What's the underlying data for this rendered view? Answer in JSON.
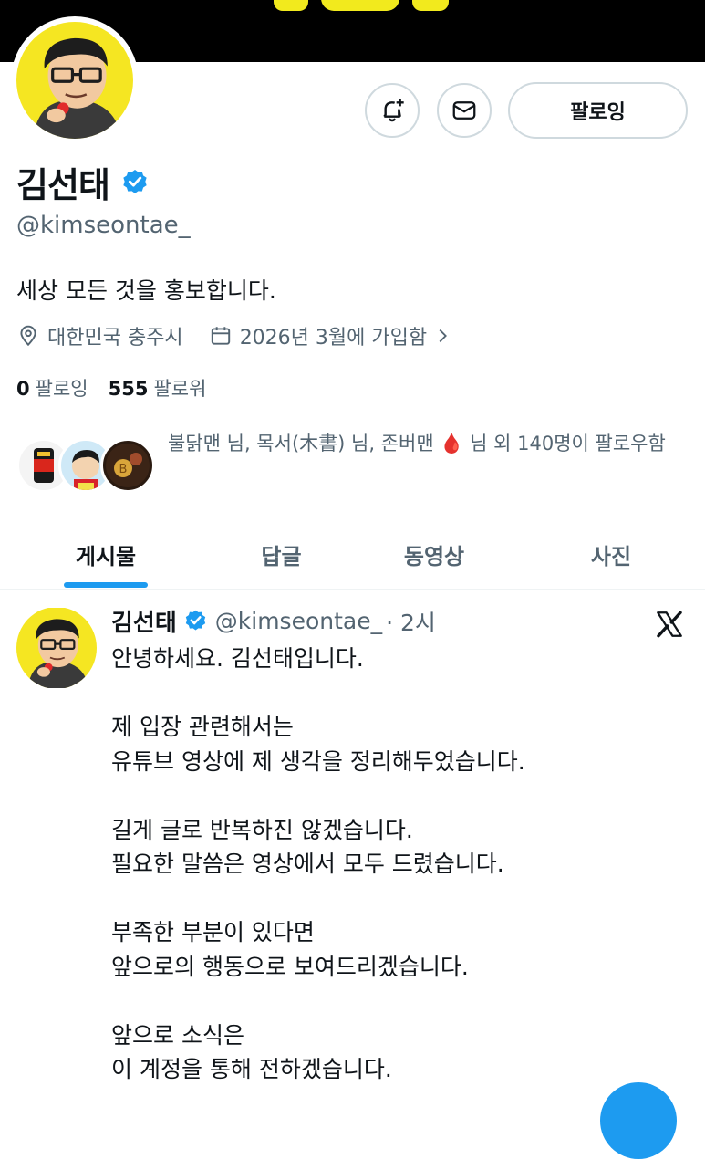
{
  "profile": {
    "name": "김선태",
    "handle": "@kimseontae_",
    "bio": "세상 모든 것을 홍보합니다.",
    "location": "대한민국 충주시",
    "joined": "2026년 3월에 가입함",
    "following_count": "0",
    "following_label": "팔로잉",
    "followers_count": "555",
    "followers_label": "팔로워",
    "followed_by_text": "불닭맨 님, 목서(木書) 님, 존버맨 🩸 님 외 140명이 팔로우함"
  },
  "actions": {
    "notify_icon": "bell-plus-icon",
    "message_icon": "envelope-icon",
    "follow_label": "팔로잉"
  },
  "tabs": [
    {
      "label": "게시물"
    },
    {
      "label": "답글"
    },
    {
      "label": "동영상"
    },
    {
      "label": "사진"
    }
  ],
  "post": {
    "author": "김선태",
    "handle": "@kimseontae_",
    "time": "· 2시",
    "body": "안녕하세요. 김선태입니다.\n\n제 입장 관련해서는\n유튜브 영상에 제 생각을 정리해두었습니다.\n\n길게 글로 반복하진 않겠습니다.\n필요한 말씀은 영상에서 모두 드렸습니다.\n\n부족한 부분이 있다면\n앞으로의 행동으로 보여드리겠습니다.\n\n앞으로 소식은\n이 계정을 통해 전하겠습니다."
  },
  "colors": {
    "accent": "#1d9bf0",
    "muted": "#536471",
    "text": "#0f1419",
    "banner_yellow": "#f2ea1d",
    "avatar_bg": "#f5e622"
  }
}
